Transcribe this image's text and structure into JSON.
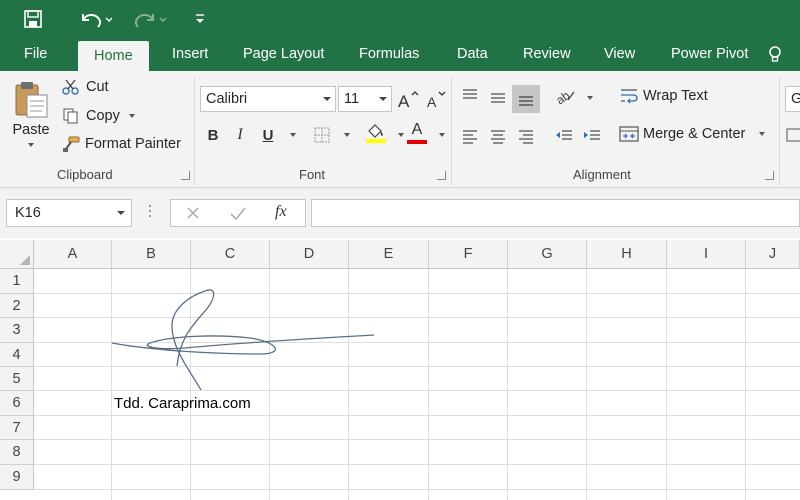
{
  "app": {
    "accent": "#217346"
  },
  "qat": {
    "save_icon": "save-icon",
    "undo_icon": "undo-icon",
    "redo_icon": "redo-icon",
    "customize_icon": "customize-qat-icon"
  },
  "tabs": [
    {
      "label": "File"
    },
    {
      "label": "Home",
      "active": true
    },
    {
      "label": "Insert"
    },
    {
      "label": "Page Layout"
    },
    {
      "label": "Formulas"
    },
    {
      "label": "Data"
    },
    {
      "label": "Review"
    },
    {
      "label": "View"
    },
    {
      "label": "Power Pivot"
    }
  ],
  "clipboard": {
    "paste_label": "Paste",
    "cut_label": "Cut",
    "copy_label": "Copy",
    "format_painter_label": "Format Painter",
    "group_label": "Clipboard"
  },
  "font": {
    "name": "Calibri",
    "size": "11",
    "bold": "B",
    "italic": "I",
    "underline": "U",
    "font_color_letter": "A",
    "group_label": "Font"
  },
  "alignment": {
    "wrap_text_label": "Wrap Text",
    "merge_center_label": "Merge & Center",
    "group_label": "Alignment"
  },
  "number": {
    "partial_label": "G"
  },
  "formula_bar": {
    "name_box": "K16",
    "fx_label": "fx",
    "value": ""
  },
  "columns": [
    "A",
    "B",
    "C",
    "D",
    "E",
    "F",
    "G",
    "H",
    "I",
    "J"
  ],
  "rows": [
    "1",
    "2",
    "3",
    "4",
    "5",
    "6",
    "7",
    "8",
    "9"
  ],
  "cells": {
    "B6": "Tdd. Caraprima.com"
  }
}
